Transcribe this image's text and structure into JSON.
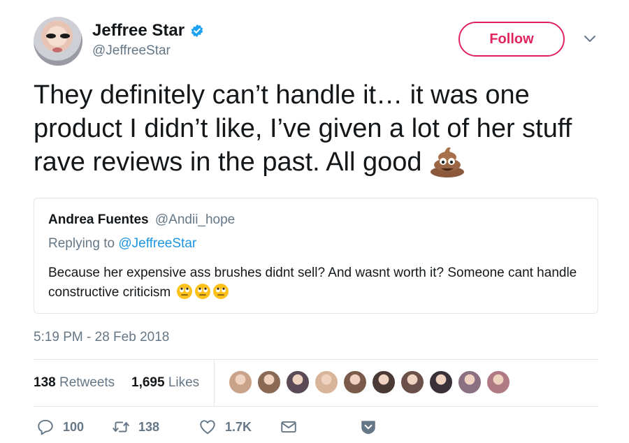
{
  "author": {
    "name": "Jeffree Star",
    "handle": "@JeffreeStar",
    "verified": true
  },
  "follow_label": "Follow",
  "tweet": {
    "text": "They definitely can’t handle it… it was one product I didn’t like, I’ve given a lot of her stuff rave reviews in the past. All good",
    "emoji": "pile-of-poo"
  },
  "quoted": {
    "name": "Andrea Fuentes",
    "handle": "@Andii_hope",
    "replying_prefix": "Replying to",
    "replying_to": "@JeffreeStar",
    "text": "Because her expensive ass brushes didnt sell? And wasnt worth it? Someone cant handle constructive criticism",
    "emoji": "face-with-rolling-eyes"
  },
  "timestamp": "5:19 PM - 28 Feb 2018",
  "stats": {
    "retweets_count": "138",
    "retweets_label": "Retweets",
    "likes_count": "1,695",
    "likes_label": "Likes"
  },
  "likers": [
    "#c9a28a",
    "#8a6a55",
    "#5a4a55",
    "#d8b49a",
    "#7a5a48",
    "#4a3a35",
    "#6a5048",
    "#3a3038",
    "#8a7080",
    "#b07a85"
  ],
  "actions": {
    "reply_count": "100",
    "retweet_count": "138",
    "like_count": "1.7K"
  },
  "colors": {
    "accent_pink": "#e0245e",
    "link_blue": "#1b95e0",
    "verified_blue": "#1da1f2",
    "muted_gray": "#657786"
  }
}
